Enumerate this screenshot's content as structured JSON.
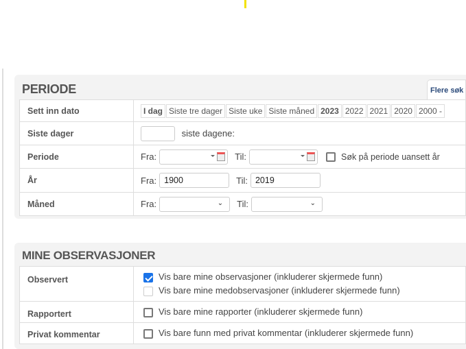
{
  "periode": {
    "title": "PERIODE",
    "tab_label": "Flere søk",
    "rows": {
      "insert_date": {
        "label": "Sett inn dato",
        "buttons": [
          "I dag",
          "Siste tre dager",
          "Siste uke",
          "Siste måned",
          "2023",
          "2022",
          "2021",
          "2020",
          "2000 -"
        ]
      },
      "last_days": {
        "label": "Siste dager",
        "value": "",
        "suffix": "siste dagene:"
      },
      "period": {
        "label": "Periode",
        "from_label": "Fra:",
        "from_value": "",
        "to_label": "Til:",
        "to_value": "",
        "checkbox_label": "Søk på periode uansett år",
        "checkbox_checked": false
      },
      "year": {
        "label": "År",
        "from_label": "Fra:",
        "from_value": "1900",
        "to_label": "Til:",
        "to_value": "2019"
      },
      "month": {
        "label": "Måned",
        "from_label": "Fra:",
        "from_value": "",
        "to_label": "Til:",
        "to_value": ""
      }
    }
  },
  "mine": {
    "title": "MINE OBSERVASJONER",
    "rows": {
      "observed": {
        "label": "Observert",
        "options": [
          {
            "label": "Vis bare mine observasjoner (inkluderer skjermede funn)",
            "checked": true
          },
          {
            "label": "Vis bare mine medobservasjoner (inkluderer skjermede funn)",
            "checked": false
          }
        ]
      },
      "reported": {
        "label": "Rapportert",
        "option": "Vis bare mine rapporter (inkluderer skjermede funn)",
        "checked": false
      },
      "private": {
        "label": "Privat kommentar",
        "option": "Vis bare funn med privat kommentar (inkluderer skjermede funn)",
        "checked": false
      }
    }
  }
}
